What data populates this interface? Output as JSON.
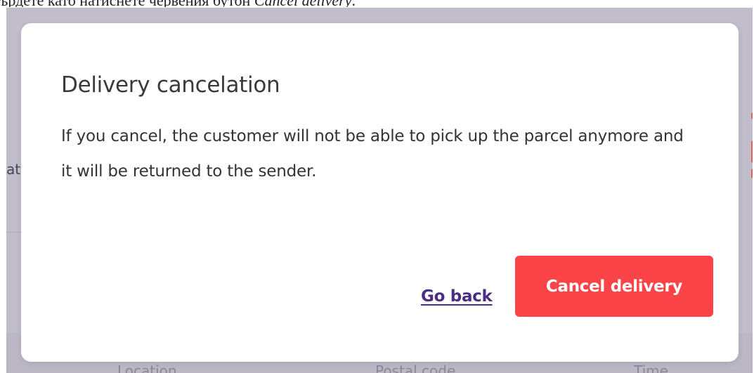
{
  "caption": {
    "text_plain": "ърдете като натиснете червения бутон ",
    "text_em": "Cancel delivery",
    "text_end": "."
  },
  "background": {
    "left_fragment": "at",
    "columns": [
      "Location",
      "Postal code",
      "Time"
    ]
  },
  "modal": {
    "title": "Delivery cancelation",
    "body": "If you cancel, the customer will not be able to pick up the parcel anymore and it will be returned to the sender.",
    "go_back_label": "Go back",
    "cancel_label": "Cancel delivery"
  },
  "colors": {
    "overlay": "#c2bdcb",
    "primary_danger": "#fb4447",
    "link": "#4b2e83"
  }
}
